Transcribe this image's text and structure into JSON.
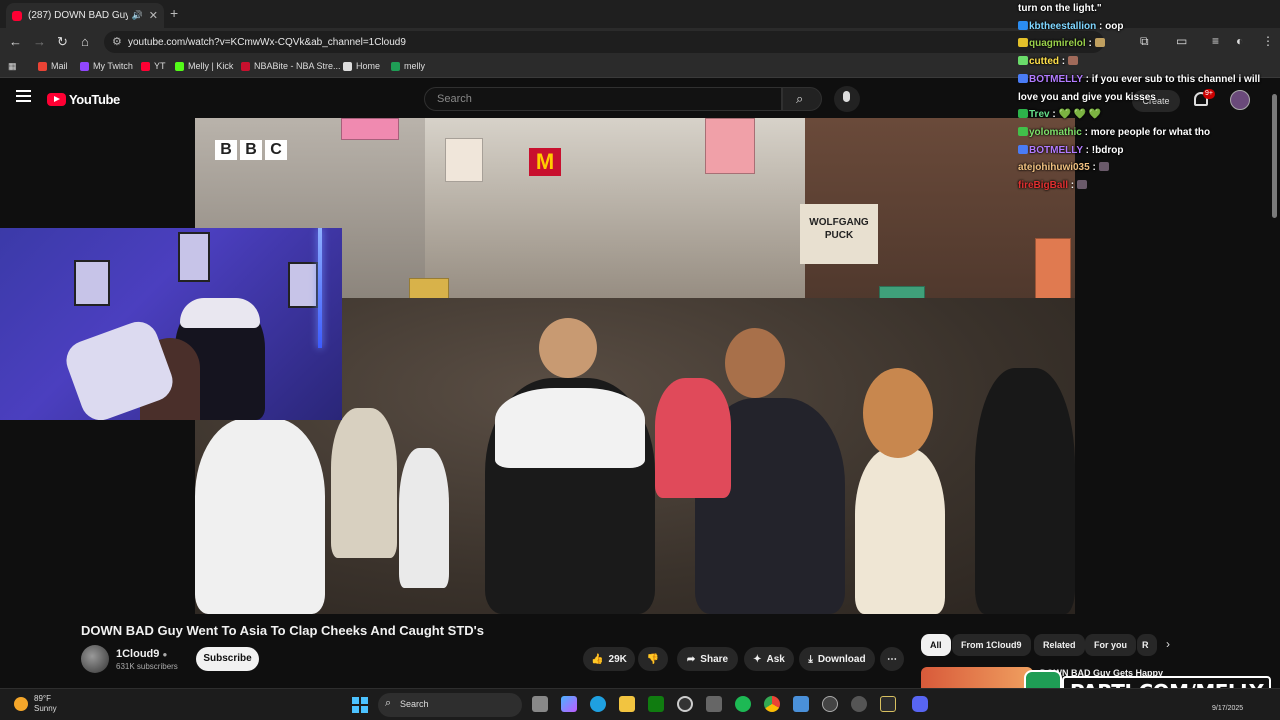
{
  "browser": {
    "tab_title": "(287) DOWN BAD Guy Went",
    "url": "youtube.com/watch?v=KCmwWx-CQVk&ab_channel=1Cloud9",
    "bookmarks": [
      "Mail",
      "My Twitch",
      "YT",
      "Melly | Kick",
      "NBABite - NBA Stre...",
      "Home",
      "melly"
    ]
  },
  "youtube": {
    "search_placeholder": "Search",
    "create_label": "Create",
    "notifications": "9+",
    "video_title": "DOWN BAD Guy Went To Asia To Clap Cheeks And Caught STD's",
    "channel_name": "1Cloud9",
    "subscribers": "631K subscribers",
    "subscribe_label": "Subscribe",
    "likes": "29K",
    "share_label": "Share",
    "ask_label": "Ask",
    "download_label": "Download",
    "chips": [
      "All",
      "From 1Cloud9",
      "Related",
      "For you",
      "R"
    ],
    "related_title": "DOWN BAD Guy Gets Happy"
  },
  "video_overlay": {
    "broadcaster": [
      "B",
      "B",
      "C"
    ],
    "shop_sign": "WOLFGANG PUCK",
    "mcd": "M"
  },
  "chat": [
    {
      "user": "",
      "text": "turn on the light.\"",
      "color": "#ffffff",
      "badge": ""
    },
    {
      "user": "kbtheestallion",
      "text": "oop",
      "color": "#7fd6ff",
      "badge": "#2b8cf0"
    },
    {
      "user": "quagmirelol",
      "text": "",
      "color": "#9ad14b",
      "badge": "#e3c02a"
    },
    {
      "user": "cutted",
      "text": "",
      "color": "#ffe04a",
      "badge": "#6adb6a"
    },
    {
      "user": "BOTMELLY",
      "text": "if you ever sub to this channel i will love you and give you kisses",
      "color": "#b27bff",
      "badge": "#4a7cf5"
    },
    {
      "user": "Trev",
      "text": "💚 💚 💚",
      "color": "#66e08a",
      "badge": "#2db34a"
    },
    {
      "user": "yolomathic",
      "text": "more people for what tho",
      "color": "#7ee06a",
      "badge": "#41c04a"
    },
    {
      "user": "BOTMELLY",
      "text": "!bdrop",
      "color": "#b27bff",
      "badge": "#4a7cf5"
    },
    {
      "user": "atejohihuwi035",
      "text": "",
      "color": "#f0c080",
      "badge": ""
    },
    {
      "user": "fireBigBall",
      "text": "",
      "color": "#e03030",
      "badge": ""
    }
  ],
  "banner": {
    "text": "PARTI.COM/MELLY"
  },
  "taskbar": {
    "temp": "89°F",
    "condition": "Sunny",
    "search_label": "Search",
    "date": "9/17/2025"
  },
  "colors": {
    "yt_red": "#ff0033",
    "bg": "#0f0f0f",
    "bell_badge": "#cc0000"
  }
}
